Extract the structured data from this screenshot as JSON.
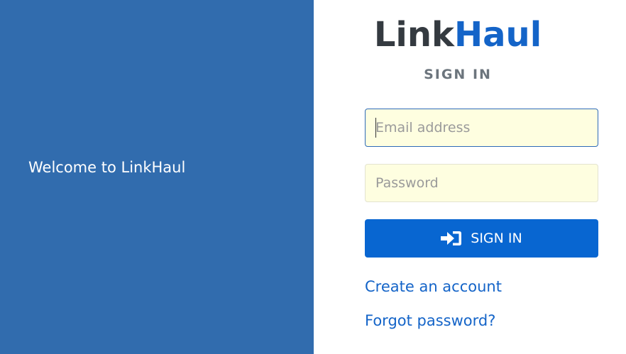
{
  "left_panel": {
    "welcome_text": "Welcome to LinkHaul",
    "background_color": "#316cae"
  },
  "logo": {
    "part_1": "Link",
    "part_2": "Haul",
    "color_part_1": "#343a40",
    "color_part_2": "#1464c8"
  },
  "form": {
    "heading": "SIGN IN",
    "email_placeholder": "Email address",
    "email_value": "",
    "password_placeholder": "Password",
    "password_value": "",
    "submit_label": "SIGN IN",
    "submit_icon": "sign-in-icon",
    "submit_color": "#0866d1"
  },
  "links": {
    "create_account": "Create an account",
    "forgot_password": "Forgot password?"
  }
}
